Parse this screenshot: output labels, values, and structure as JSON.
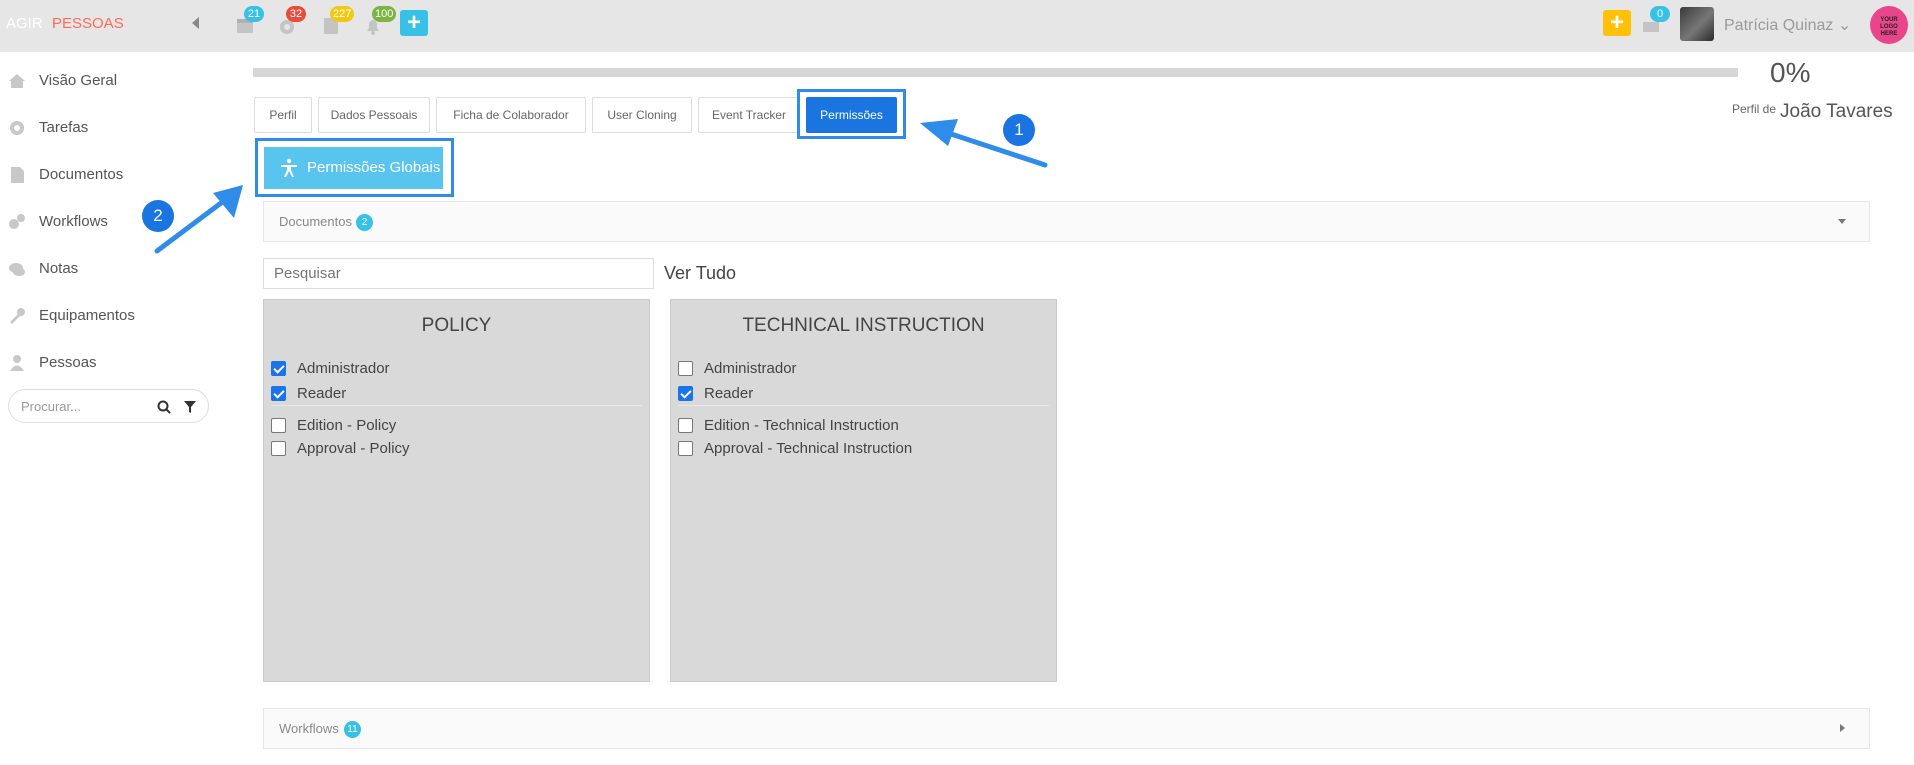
{
  "app": {
    "brand_primary": "AGIR",
    "brand_secondary": "PESSOAS"
  },
  "topbar": {
    "badges": {
      "calendar": "21",
      "settings": "32",
      "tasks": "227",
      "notifications": "100",
      "messages": "0"
    },
    "user_name": "Patrícia Quinaz",
    "logo_text": "YOUR LOGO HERE",
    "colors": {
      "accent_yellow": "#ffc107",
      "accent_blue": "#37c1e7"
    }
  },
  "sidebar": {
    "items": [
      {
        "label": "Visão Geral",
        "icon": "home-icon"
      },
      {
        "label": "Tarefas",
        "icon": "gear-icon"
      },
      {
        "label": "Documentos",
        "icon": "document-icon"
      },
      {
        "label": "Workflows",
        "icon": "cogs-icon"
      },
      {
        "label": "Notas",
        "icon": "chat-icon"
      },
      {
        "label": "Equipamentos",
        "icon": "wrench-icon"
      },
      {
        "label": "Pessoas",
        "icon": "person-icon"
      }
    ],
    "search_placeholder": "Procurar..."
  },
  "profile": {
    "progress": "0%",
    "progress_value": 0,
    "of_label": "Perfil de",
    "name": "João Tavares"
  },
  "tabs": [
    {
      "label": "Perfil",
      "active": false
    },
    {
      "label": "Dados Pessoais",
      "active": false
    },
    {
      "label": "Ficha de Colaborador",
      "active": false
    },
    {
      "label": "User Cloning",
      "active": false
    },
    {
      "label": "Event Tracker",
      "active": false
    },
    {
      "label": "Permissões",
      "active": true
    }
  ],
  "global_permissions_label": "Permissões Globais",
  "documents_section": {
    "label": "Documentos",
    "count": "2"
  },
  "search": {
    "placeholder": "Pesquisar"
  },
  "view_all": "Ver Tudo",
  "panels": [
    {
      "title": "POLICY",
      "roles": [
        {
          "label": "Administrador",
          "checked": true
        },
        {
          "label": "Reader",
          "checked": true
        },
        {
          "label": "Edition - Policy",
          "checked": false
        },
        {
          "label": "Approval - Policy",
          "checked": false
        }
      ]
    },
    {
      "title": "TECHNICAL INSTRUCTION",
      "roles": [
        {
          "label": "Administrador",
          "checked": false
        },
        {
          "label": "Reader",
          "checked": true
        },
        {
          "label": "Edition - Technical Instruction",
          "checked": false
        },
        {
          "label": "Approval - Technical Instruction",
          "checked": false
        }
      ]
    }
  ],
  "workflows_section": {
    "label": "Workflows",
    "count": "11"
  },
  "annotations": {
    "step1": "1",
    "step2": "2"
  }
}
